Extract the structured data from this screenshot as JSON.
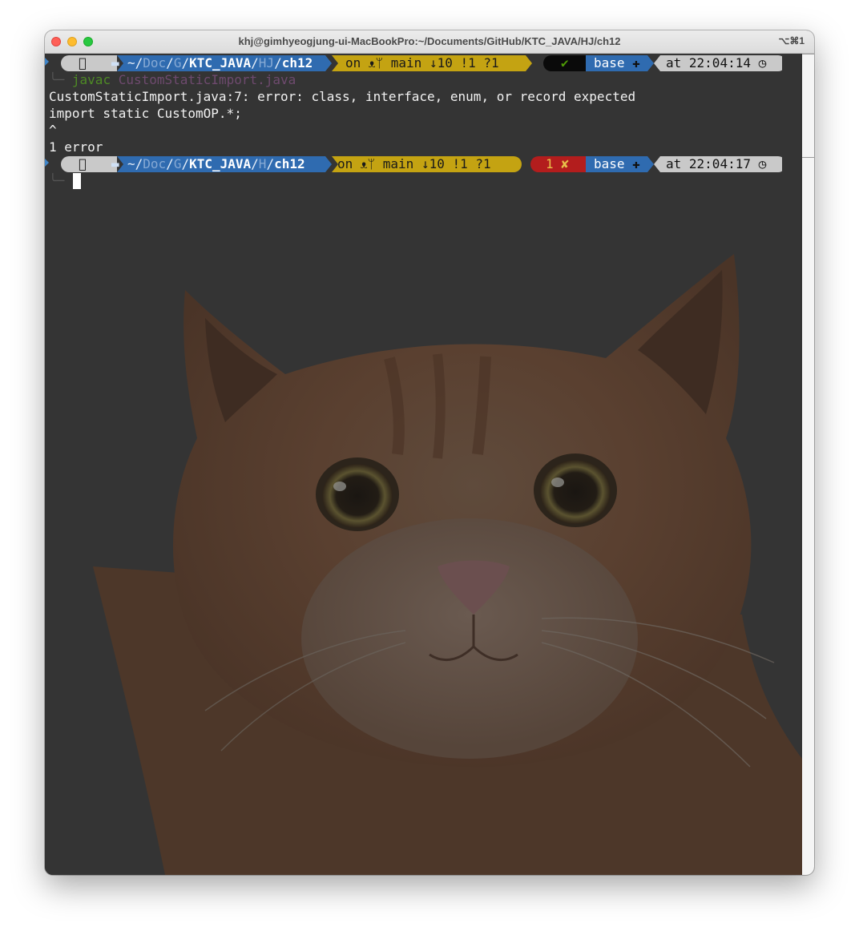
{
  "window": {
    "title": "khj@gimhyeogjung-ui-MacBookPro:~/Documents/GitHub/KTC_JAVA/HJ/ch12",
    "shortcut": "⌥⌘1"
  },
  "colors": {
    "path_bg": "#2f6bb0",
    "git_bg": "#c4a312",
    "ok_bg": "#0a0a0a",
    "err_bg": "#b31d1d",
    "env_bg": "#2f6bb0",
    "time_bg": "#c9c9c9",
    "terminal_bg": "#343434"
  },
  "prompts": [
    {
      "apple_icon": "apple-icon",
      "folder_icon": "folder-icon",
      "path": {
        "tilde": "~/",
        "doc": "Doc",
        "sep1": "/",
        "g": "G",
        "sep2": "/",
        "repo": "KTC_JAVA",
        "sep3": "/",
        "sub": "HJ",
        "sep4": "/",
        "cwd": "ch12"
      },
      "git": {
        "on": "on",
        "github_icon": "github-icon",
        "branch_icon": "branch-icon",
        "branch": "main",
        "behind": "↓10",
        "modified": "!1",
        "untracked": "?1"
      },
      "status": {
        "text": "✔",
        "kind": "ok"
      },
      "env": {
        "name": "base",
        "icon": "python-icon"
      },
      "time": {
        "at": "at",
        "value": "22:04:14",
        "clock_icon": "clock-icon"
      }
    },
    {
      "apple_icon": "apple-icon",
      "folder_icon": "folder-icon",
      "path": {
        "tilde": "~/",
        "doc": "Doc",
        "sep1": "/",
        "g": "G",
        "sep2": "/",
        "repo": "KTC_JAVA",
        "sep3": "/",
        "sub": "H",
        "sep4": "/",
        "cwd": "ch12"
      },
      "git": {
        "on": "on",
        "github_icon": "github-icon",
        "branch_icon": "branch-icon",
        "branch": "main",
        "behind": "↓10",
        "modified": "!1",
        "untracked": "?1"
      },
      "status": {
        "text": "1 ✘",
        "kind": "error"
      },
      "env": {
        "name": "base",
        "icon": "python-icon"
      },
      "time": {
        "at": "at",
        "value": "22:04:17",
        "clock_icon": "clock-icon"
      }
    }
  ],
  "command": {
    "prefix": "╰─",
    "cmd": "javac",
    "arg": "CustomStaticImport.java"
  },
  "output": [
    "CustomStaticImport.java:7: error: class, interface, enum, or record expected",
    "import static CustomOP.*;",
    "^",
    "1 error"
  ],
  "second_prompt_prefix": "╰─"
}
